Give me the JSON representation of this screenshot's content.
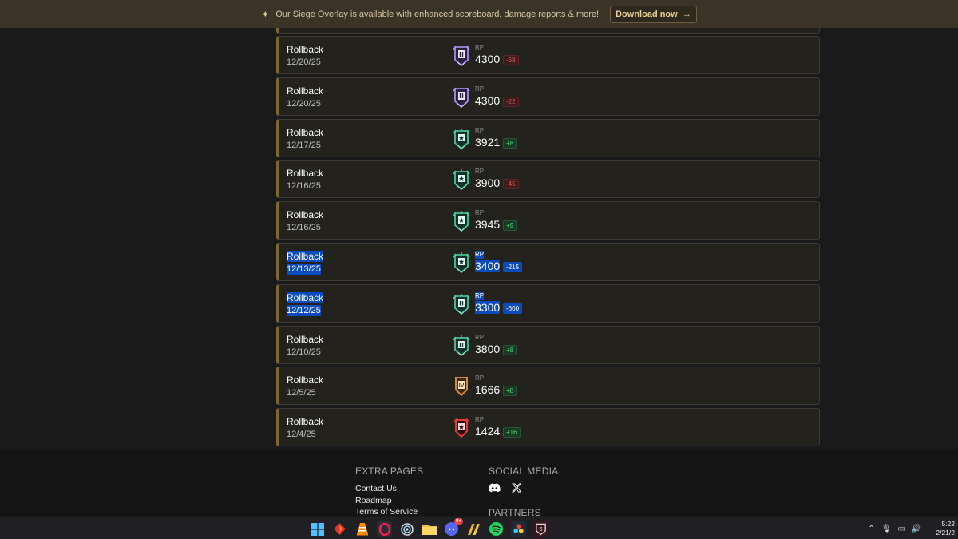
{
  "banner": {
    "text": "Our Siege Overlay is available with enhanced scoreboard, damage reports & more!",
    "button_label": "Download now",
    "button_arrow": "→"
  },
  "rows": [
    {
      "name": "Rollback",
      "date": "12/20/25",
      "rp_label": "RP",
      "rp": "4300",
      "delta": "-69",
      "delta_type": "neg",
      "rank": "emerald-purple",
      "selected": false
    },
    {
      "name": "Rollback",
      "date": "12/20/25",
      "rp_label": "RP",
      "rp": "4300",
      "delta": "-22",
      "delta_type": "neg",
      "rank": "emerald-purple",
      "selected": false
    },
    {
      "name": "Rollback",
      "date": "12/17/25",
      "rp_label": "RP",
      "rp": "3921",
      "delta": "+8",
      "delta_type": "pos",
      "rank": "platinum-star",
      "selected": false
    },
    {
      "name": "Rollback",
      "date": "12/16/25",
      "rp_label": "RP",
      "rp": "3900",
      "delta": "-45",
      "delta_type": "neg",
      "rank": "platinum-star",
      "selected": false
    },
    {
      "name": "Rollback",
      "date": "12/16/25",
      "rp_label": "RP",
      "rp": "3945",
      "delta": "+9",
      "delta_type": "pos",
      "rank": "platinum-star",
      "selected": false
    },
    {
      "name": "Rollback",
      "date": "12/13/25",
      "rp_label": "RP",
      "rp": "3400",
      "delta": "-215",
      "delta_type": "neg",
      "rank": "platinum-star",
      "selected": true
    },
    {
      "name": "Rollback",
      "date": "12/12/25",
      "rp_label": "RP",
      "rp": "3300",
      "delta": "-600",
      "delta_type": "neg",
      "rank": "platinum-ii",
      "selected": true
    },
    {
      "name": "Rollback",
      "date": "12/10/25",
      "rp_label": "RP",
      "rp": "3800",
      "delta": "+8",
      "delta_type": "pos",
      "rank": "platinum-ii",
      "selected": false
    },
    {
      "name": "Rollback",
      "date": "12/5/25",
      "rp_label": "RP",
      "rp": "1666",
      "delta": "+8",
      "delta_type": "pos",
      "rank": "bronze-iv",
      "selected": false
    },
    {
      "name": "Rollback",
      "date": "12/4/25",
      "rp_label": "RP",
      "rp": "1424",
      "delta": "+16",
      "delta_type": "pos",
      "rank": "copper-star",
      "selected": false
    }
  ],
  "footer": {
    "extra_title": "EXTRA PAGES",
    "extra_links": [
      "Contact Us",
      "Roadmap",
      "Terms of Service"
    ],
    "social_title": "SOCIAL MEDIA",
    "partners_title": "PARTNERS"
  },
  "taskbar": {
    "discord_badge": "9+",
    "time": "5:22",
    "date": "2/21/2"
  },
  "colors": {
    "accent_gold": "#7a6733",
    "positive": "#5fd17d",
    "negative": "#e05757",
    "selection": "#0a4bbd"
  }
}
